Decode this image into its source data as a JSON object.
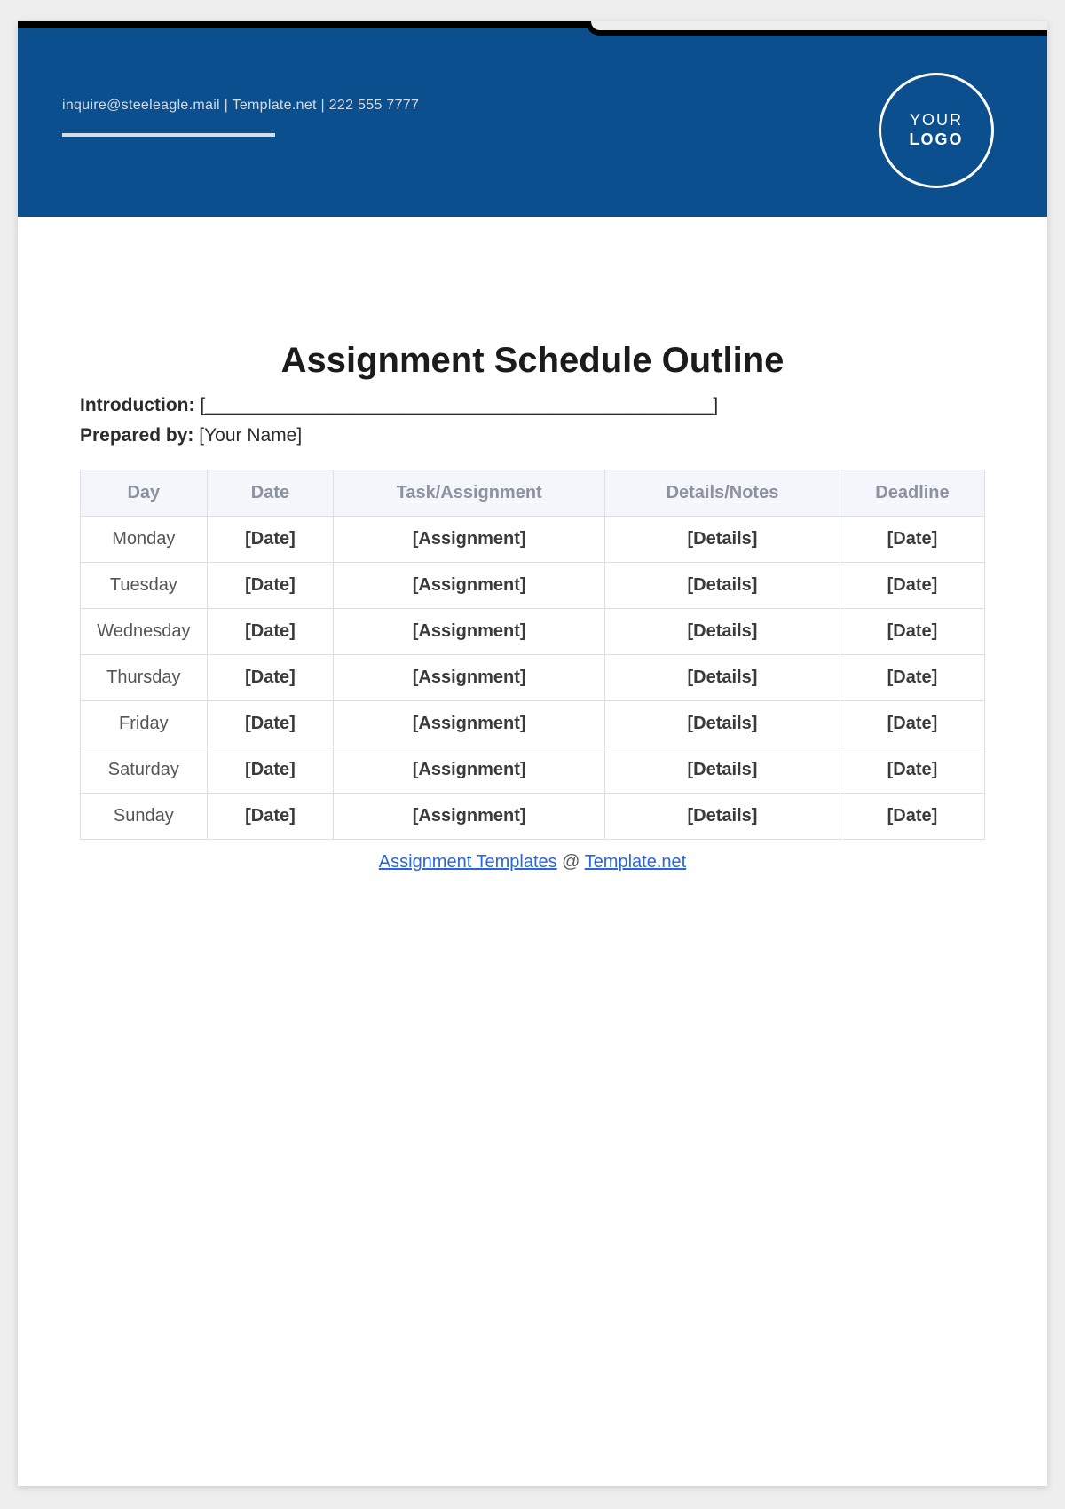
{
  "header": {
    "contact": "inquire@steeleagle.mail  |  Template.net  |  222 555 7777",
    "logo_line1": "YOUR",
    "logo_line2": "LOGO"
  },
  "document": {
    "title": "Assignment Schedule Outline",
    "introduction_label": "Introduction:",
    "introduction_value": "[_________________________________________________]",
    "prepared_label": "Prepared by:",
    "prepared_value": "[Your Name]"
  },
  "table": {
    "headers": {
      "day": "Day",
      "date": "Date",
      "task": "Task/Assignment",
      "details": "Details/Notes",
      "deadline": "Deadline"
    },
    "rows": [
      {
        "day": "Monday",
        "date": "[Date]",
        "task": "[Assignment]",
        "details": "[Details]",
        "deadline": "[Date]"
      },
      {
        "day": "Tuesday",
        "date": "[Date]",
        "task": "[Assignment]",
        "details": "[Details]",
        "deadline": "[Date]"
      },
      {
        "day": "Wednesday",
        "date": "[Date]",
        "task": "[Assignment]",
        "details": "[Details]",
        "deadline": "[Date]"
      },
      {
        "day": "Thursday",
        "date": "[Date]",
        "task": "[Assignment]",
        "details": "[Details]",
        "deadline": "[Date]"
      },
      {
        "day": "Friday",
        "date": "[Date]",
        "task": "[Assignment]",
        "details": "[Details]",
        "deadline": "[Date]"
      },
      {
        "day": "Saturday",
        "date": "[Date]",
        "task": "[Assignment]",
        "details": "[Details]",
        "deadline": "[Date]"
      },
      {
        "day": "Sunday",
        "date": "[Date]",
        "task": "[Assignment]",
        "details": "[Details]",
        "deadline": "[Date]"
      }
    ]
  },
  "footer": {
    "link1_text": "Assignment Templates",
    "separator": " @ ",
    "link2_text": "Template.net"
  }
}
